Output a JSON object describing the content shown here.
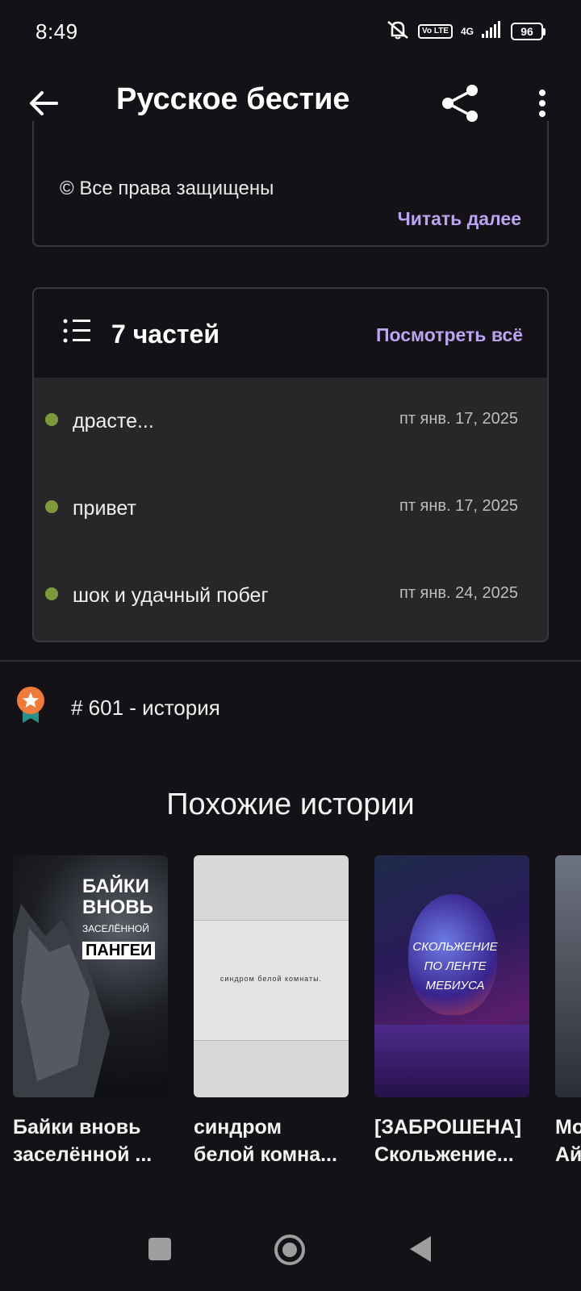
{
  "status_bar": {
    "time": "8:49",
    "volte": "Vo LTE",
    "network": "4G",
    "battery": "96"
  },
  "app_bar": {
    "title": "Русское бестие",
    "back_icon": "arrow-left-icon",
    "share_icon": "share-icon",
    "more_icon": "more-vertical-icon"
  },
  "description": {
    "rights": "© Все права защищены",
    "read_more": "Читать далее"
  },
  "parts": {
    "count_label": "7 частей",
    "see_all": "Посмотреть всё",
    "items": [
      {
        "title": "драсте...",
        "date": "пт янв. 17, 2025"
      },
      {
        "title": "привет",
        "date": "пт янв. 17, 2025"
      },
      {
        "title": "шок и удачный побег",
        "date": "пт янв. 24, 2025"
      }
    ],
    "accent_color": "#b9a6f0",
    "dot_color": "#7d9a3c"
  },
  "ranking": {
    "text": "# 601 - история",
    "icon": "award-badge-icon"
  },
  "similar": {
    "heading": "Похожие истории",
    "stories": [
      {
        "title_line1": "Байки вновь",
        "title_line2": "заселённой ...",
        "cover_line1": "БАЙКИ",
        "cover_line2": "ВНОВЬ",
        "cover_line3": "ЗАСЕЛЁННОЙ",
        "cover_line4": "ПАНГЕИ"
      },
      {
        "title_line1": "синдром",
        "title_line2": "белой комна...",
        "cover_text": "синдром белой комнаты."
      },
      {
        "title_line1": "[ЗАБРОШЕНА]",
        "title_line2": "Скольжение...",
        "cover_line1": "СКОЛЬЖЕНИЕ",
        "cover_line2": "ПО ЛЕНТЕ",
        "cover_line3": "МЕБИУСА"
      },
      {
        "title_line1": "Мо",
        "title_line2": "Ай"
      }
    ]
  },
  "nav": {
    "recents": "recents-square-icon",
    "home": "home-circle-icon",
    "back": "back-triangle-icon"
  }
}
